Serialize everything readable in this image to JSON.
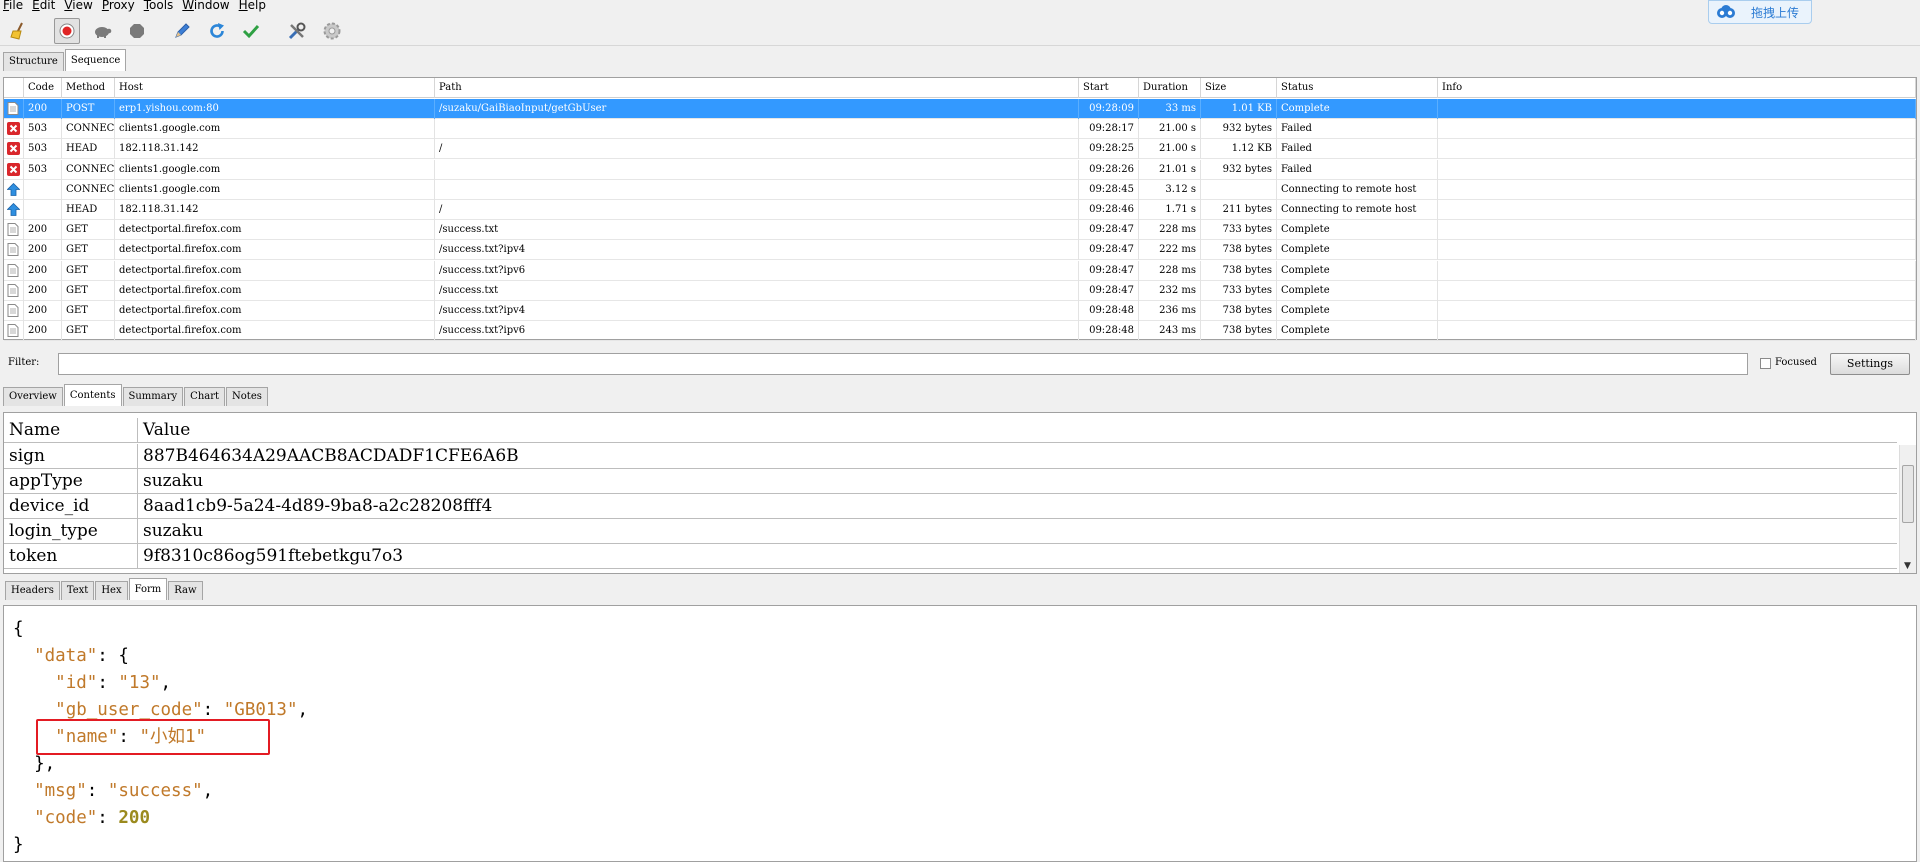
{
  "menu": [
    {
      "label": "File",
      "u": "F"
    },
    {
      "label": "Edit",
      "u": "E"
    },
    {
      "label": "View",
      "u": "V"
    },
    {
      "label": "Proxy",
      "u": "P"
    },
    {
      "label": "Tools",
      "u": "T"
    },
    {
      "label": "Window",
      "u": "W"
    },
    {
      "label": "Help",
      "u": "H"
    }
  ],
  "upload_button": {
    "label": "拖拽上传"
  },
  "toolbar_icons": [
    "broom-icon",
    "record-icon",
    "turtle-icon",
    "stop-icon",
    "pen-icon",
    "refresh-icon",
    "check-icon",
    "tools-icon",
    "gear-icon"
  ],
  "top_tabs": [
    "Structure",
    "Sequence"
  ],
  "top_tabs_active": "Sequence",
  "sequence": {
    "columns": [
      "Code",
      "Method",
      "Host",
      "Path",
      "Start",
      "Duration",
      "Size",
      "Status",
      "Info"
    ],
    "rows": [
      {
        "icon": "doc",
        "code": "200",
        "method": "POST",
        "host": "erp1.yishou.com:80",
        "path": "/suzaku/GaiBiaoInput/getGbUser",
        "start": "09:28:09",
        "duration": "33 ms",
        "size": "1.01 KB",
        "status": "Complete",
        "info": "",
        "selected": true
      },
      {
        "icon": "error",
        "code": "503",
        "method": "CONNECT",
        "host": "clients1.google.com",
        "path": "",
        "start": "09:28:17",
        "duration": "21.00 s",
        "size": "932 bytes",
        "status": "Failed",
        "info": ""
      },
      {
        "icon": "error",
        "code": "503",
        "method": "HEAD",
        "host": "182.118.31.142",
        "path": "/",
        "start": "09:28:25",
        "duration": "21.00 s",
        "size": "1.12 KB",
        "status": "Failed",
        "info": ""
      },
      {
        "icon": "error",
        "code": "503",
        "method": "CONNECT",
        "host": "clients1.google.com",
        "path": "",
        "start": "09:28:26",
        "duration": "21.01 s",
        "size": "932 bytes",
        "status": "Failed",
        "info": ""
      },
      {
        "icon": "upload",
        "code": "",
        "method": "CONNECT",
        "host": "clients1.google.com",
        "path": "",
        "start": "09:28:45",
        "duration": "3.12 s",
        "size": "",
        "status": "Connecting to remote host",
        "info": ""
      },
      {
        "icon": "upload",
        "code": "",
        "method": "HEAD",
        "host": "182.118.31.142",
        "path": "/",
        "start": "09:28:46",
        "duration": "1.71 s",
        "size": "211 bytes",
        "status": "Connecting to remote host",
        "info": ""
      },
      {
        "icon": "doc",
        "code": "200",
        "method": "GET",
        "host": "detectportal.firefox.com",
        "path": "/success.txt",
        "start": "09:28:47",
        "duration": "228 ms",
        "size": "733 bytes",
        "status": "Complete",
        "info": ""
      },
      {
        "icon": "doc",
        "code": "200",
        "method": "GET",
        "host": "detectportal.firefox.com",
        "path": "/success.txt?ipv4",
        "start": "09:28:47",
        "duration": "222 ms",
        "size": "738 bytes",
        "status": "Complete",
        "info": ""
      },
      {
        "icon": "doc",
        "code": "200",
        "method": "GET",
        "host": "detectportal.firefox.com",
        "path": "/success.txt?ipv6",
        "start": "09:28:47",
        "duration": "228 ms",
        "size": "738 bytes",
        "status": "Complete",
        "info": ""
      },
      {
        "icon": "doc",
        "code": "200",
        "method": "GET",
        "host": "detectportal.firefox.com",
        "path": "/success.txt",
        "start": "09:28:47",
        "duration": "232 ms",
        "size": "733 bytes",
        "status": "Complete",
        "info": ""
      },
      {
        "icon": "doc",
        "code": "200",
        "method": "GET",
        "host": "detectportal.firefox.com",
        "path": "/success.txt?ipv4",
        "start": "09:28:48",
        "duration": "236 ms",
        "size": "738 bytes",
        "status": "Complete",
        "info": ""
      },
      {
        "icon": "doc",
        "code": "200",
        "method": "GET",
        "host": "detectportal.firefox.com",
        "path": "/success.txt?ipv6",
        "start": "09:28:48",
        "duration": "243 ms",
        "size": "738 bytes",
        "status": "Complete",
        "info": ""
      }
    ]
  },
  "filter": {
    "label": "Filter:",
    "value": "",
    "focused_label": "Focused",
    "settings_label": "Settings"
  },
  "detail_tabs": [
    "Overview",
    "Contents",
    "Summary",
    "Chart",
    "Notes"
  ],
  "detail_tabs_active": "Contents",
  "form_table": {
    "columns": [
      "Name",
      "Value"
    ],
    "rows": [
      {
        "name": "sign",
        "value": "887B464634A29AACB8ACDADF1CFE6A6B"
      },
      {
        "name": "appType",
        "value": "suzaku"
      },
      {
        "name": "device_id",
        "value": "8aad1cb9-5a24-4d89-9ba8-a2c28208fff4"
      },
      {
        "name": "login_type",
        "value": "suzaku"
      },
      {
        "name": "token",
        "value": "9f8310c86og591ftebetkgu7o3"
      }
    ]
  },
  "view_tabs": [
    "Headers",
    "Text",
    "Hex",
    "Form",
    "Raw"
  ],
  "view_tabs_active": "Form",
  "response_json": {
    "open_brace": "{",
    "data_key": "\"data\"",
    "data_open": ": {",
    "id_key": "\"id\"",
    "id_value": "\"13\"",
    "gb_key": "\"gb_user_code\"",
    "gb_value": "\"GB013\"",
    "name_key": "\"name\"",
    "name_value": "\"小如1\"",
    "data_close": "},",
    "msg_key": "\"msg\"",
    "msg_value": "\"success\"",
    "code_key": "\"code\"",
    "code_value": "200",
    "close_brace": "}"
  },
  "colors": {
    "selection": "#3399ff",
    "json_key": "#c0792a",
    "json_number": "#9b8a1e",
    "highlight_box": "#e31b23",
    "error_icon": "#d9262b",
    "upload_icon": "#2f8fe0"
  }
}
